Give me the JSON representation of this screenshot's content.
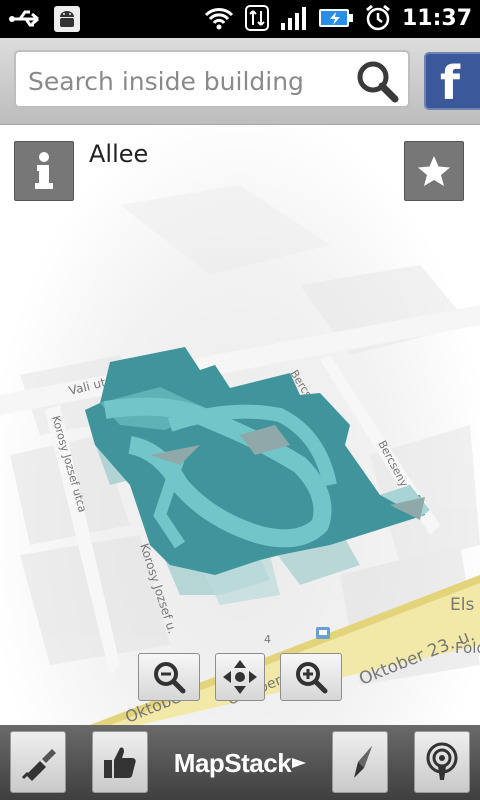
{
  "status_bar": {
    "time": "11:37",
    "icons": [
      "usb-icon",
      "android-debug-icon",
      "wifi-icon",
      "data-transfer-icon",
      "signal-icon",
      "battery-charging-icon",
      "alarm-icon"
    ]
  },
  "search": {
    "placeholder": "Search inside building"
  },
  "social": {
    "facebook_label": "f"
  },
  "place": {
    "title": "Allee"
  },
  "map": {
    "streets": [
      "Vali utca",
      "Bercsenyi utca",
      "Bercsenyi utca",
      "Korosy Jozsef utca",
      "Korosy Jozsef u.",
      "Oktober 23. u.",
      "Oktober 23. u.",
      "Oktober"
    ],
    "labels_right": [
      "Els",
      "Fold"
    ],
    "numbers": [
      "4"
    ],
    "colors": {
      "building": "#3f959b",
      "corridor": "#72c6c9",
      "annex": "#a8cfd0"
    }
  },
  "controls": {
    "zoom_out": "zoom-out",
    "pan": "pan",
    "zoom_in": "zoom-in"
  },
  "bottom_bar": {
    "brand": "MapStack"
  }
}
